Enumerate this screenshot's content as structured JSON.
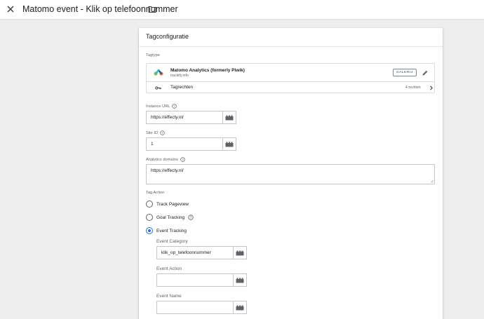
{
  "header": {
    "title": "Matomo event - Klik op telefoonnummer",
    "close_icon": "close-icon",
    "folder_icon": "folder-icon"
  },
  "card": {
    "title": "Tagconfiguratie",
    "tagtype": {
      "section_label": "Tagtype",
      "name": "Matomo Analytics (formerly Piwik)",
      "publisher": "trackify.info",
      "gallery_label": "GALERIJ",
      "permissions_label": "Tagrechten",
      "permissions_count": "4 rechten"
    },
    "instance_url": {
      "label": "Instance URL",
      "value": "https://effecty.nl/"
    },
    "site_id": {
      "label": "Site ID",
      "value": "1"
    },
    "analytics_domains": {
      "label": "Analytics domains",
      "value": "https://effecty.nl/"
    },
    "tag_action": {
      "label": "Tag Action",
      "options": [
        {
          "label": "Track Pageview",
          "selected": false
        },
        {
          "label": "Goal Tracking",
          "selected": false
        },
        {
          "label": "Event Tracking",
          "selected": true
        }
      ]
    },
    "event": {
      "category_label": "Event Category",
      "category_value": "klik_op_telefoonnummer",
      "action_label": "Event Action",
      "action_value": "",
      "name_label": "Event Name",
      "name_value": ""
    }
  },
  "colors": {
    "accent": "#1a73e8",
    "background": "#eeeeee",
    "card": "#ffffff"
  }
}
